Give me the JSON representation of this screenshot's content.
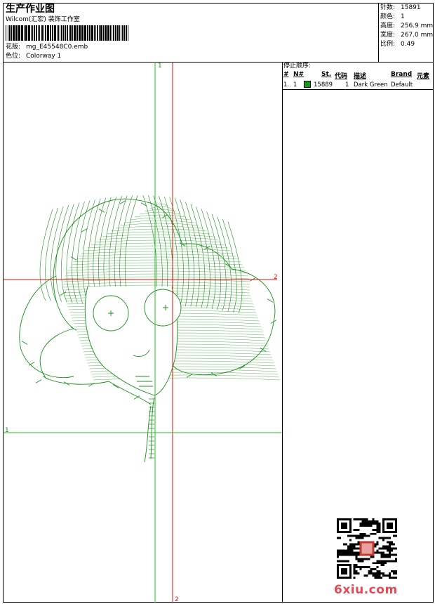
{
  "header": {
    "title": "生产作业图",
    "company": "Wilcom(汇宏) 装饰工作室",
    "design_label": "花版:",
    "design_value": "mg_E45548C0.emb",
    "colorway_label": "色位:",
    "colorway_value": "Colorway 1"
  },
  "stats": {
    "stitches_label": "针数:",
    "stitches_value": "15891",
    "colors_label": "颜色:",
    "colors_value": "1",
    "height_label": "高度:",
    "height_value": "256.9 mm",
    "width_label": "宽度:",
    "width_value": "267.0 mm",
    "scale_label": "比例:",
    "scale_value": "0.49"
  },
  "stop_sequence": {
    "title": "停止顺序:",
    "columns": [
      "#",
      "N#",
      "St.",
      "代码",
      "描述",
      "Brand",
      "元素"
    ],
    "rows": [
      {
        "num": "1.",
        "n": "1",
        "color": "#1a9a1a",
        "stitches": "15889",
        "code": "1",
        "description": "Dark Green",
        "brand": "Default"
      }
    ]
  },
  "guides": {
    "top_label": "1",
    "right_label": "2",
    "left_label": "1",
    "bottom_label": "2"
  },
  "watermark": "6xiu.com",
  "colors": {
    "guide_green": "#22c122",
    "guide_red": "#e01010",
    "stitch_green": "#1a8f1a"
  }
}
